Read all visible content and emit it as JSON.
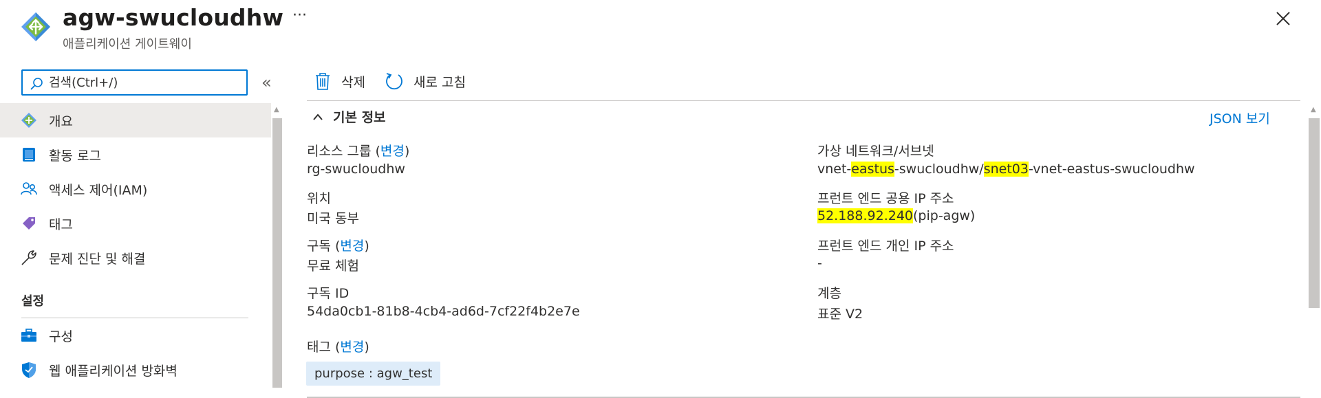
{
  "header": {
    "title": "agw-swucloudhw",
    "subtitle": "애플리케이션 게이트웨이",
    "more": "···"
  },
  "sidebar": {
    "search_value": "검색(Ctrl+/)",
    "collapse": "«",
    "items": [
      {
        "label": "개요",
        "icon": "overview-diamond-icon"
      },
      {
        "label": "활동 로그",
        "icon": "activity-log-icon"
      },
      {
        "label": "액세스 제어(IAM)",
        "icon": "people-icon"
      },
      {
        "label": "태그",
        "icon": "tag-icon"
      },
      {
        "label": "문제 진단 및 해결",
        "icon": "wrench-icon"
      }
    ],
    "section": "설정",
    "settings_items": [
      {
        "label": "구성",
        "icon": "toolbox-icon"
      },
      {
        "label": "웹 애플리케이션 방화벽",
        "icon": "shield-icon"
      }
    ]
  },
  "toolbar": {
    "delete_label": "삭제",
    "refresh_label": "새로 고침"
  },
  "essentials": {
    "title": "기본 정보",
    "json_view": "JSON 보기",
    "resource_group": {
      "label": "리소스 그룹 (",
      "change": "변경",
      "close": ")",
      "value": "rg-swucloudhw"
    },
    "location": {
      "label": "위치",
      "value": "미국 동부"
    },
    "subscription": {
      "label": "구독 (",
      "change": "변경",
      "close": ")",
      "value": "무료 체험"
    },
    "subscription_id": {
      "label": "구독 ID",
      "value": "54da0cb1-81b8-4cb4-ad6d-7cf22f4b2e7e"
    },
    "vnet": {
      "label": "가상 네트워크/서브넷",
      "p1": "vnet-",
      "p2": "eastus",
      "p3": "-swucloudhw/",
      "p4": "snet03",
      "p5": "-vnet-eastus-swucloudhw"
    },
    "frontend_public_ip": {
      "label": "프런트 엔드 공용 IP 주소",
      "ip": "52.188.92.240",
      "name": "(pip-agw)"
    },
    "frontend_private_ip": {
      "label": "프런트 엔드 개인 IP 주소",
      "value": "-"
    },
    "tier": {
      "label": "계층",
      "value": "표준 V2"
    },
    "tags": {
      "label": "태그 (",
      "change": "변경",
      "close": ")",
      "chip": "purpose : agw_test"
    }
  },
  "colors": {
    "accent": "#0078d4",
    "highlight": "#ffff00",
    "selected": "#edebe9"
  }
}
